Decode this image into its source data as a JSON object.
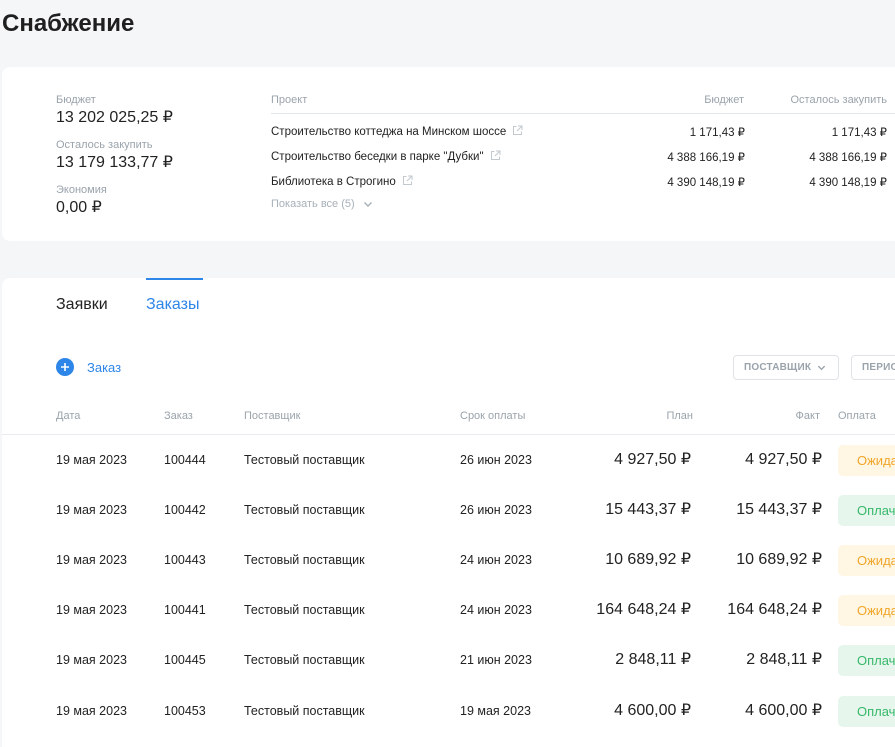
{
  "page": {
    "title": "Снабжение"
  },
  "summary": {
    "budget": {
      "label": "Бюджет",
      "value": "13 202 025,25 ₽"
    },
    "remaining": {
      "label": "Осталось закупить",
      "value": "13 179 133,77 ₽"
    },
    "savings": {
      "label": "Экономия",
      "value": "0,00 ₽"
    }
  },
  "projects": {
    "headers": {
      "project": "Проект",
      "budget": "Бюджет",
      "remaining": "Осталось закупить"
    },
    "rows": [
      {
        "name": "Строительство коттеджа на Минском шоссе",
        "budget": "1 171,43 ₽",
        "remaining": "1 171,43 ₽"
      },
      {
        "name": "Строительство беседки в парке \"Дубки\"",
        "budget": "4 388 166,19 ₽",
        "remaining": "4 388 166,19 ₽"
      },
      {
        "name": "Библиотека в Строгино",
        "budget": "4 390 148,19 ₽",
        "remaining": "4 390 148,19 ₽"
      }
    ],
    "show_all": "Показать все (5)"
  },
  "tabs": [
    {
      "label": "Заявки"
    },
    {
      "label": "Заказы"
    }
  ],
  "toolbar": {
    "add_label": "Заказ",
    "filter_supplier": "ПОСТАВЩИК",
    "filter_period": "ПЕРИОД"
  },
  "table": {
    "headers": {
      "date": "Дата",
      "order": "Заказ",
      "supplier": "Поставщик",
      "due": "Срок оплаты",
      "plan": "План",
      "fact": "Факт",
      "payment": "Оплата"
    },
    "rows": [
      {
        "date": "19 мая 2023",
        "order": "100444",
        "supplier": "Тестовый поставщик",
        "due": "26 июн 2023",
        "plan": "4 927,50 ₽",
        "fact": "4 927,50 ₽",
        "status": "Ожидает",
        "status_kind": "wait"
      },
      {
        "date": "19 мая 2023",
        "order": "100442",
        "supplier": "Тестовый поставщик",
        "due": "26 июн 2023",
        "plan": "15 443,37 ₽",
        "fact": "15 443,37 ₽",
        "status": "Оплачен",
        "status_kind": "paid"
      },
      {
        "date": "19 мая 2023",
        "order": "100443",
        "supplier": "Тестовый поставщик",
        "due": "24 июн 2023",
        "plan": "10 689,92 ₽",
        "fact": "10 689,92 ₽",
        "status": "Ожидает",
        "status_kind": "wait"
      },
      {
        "date": "19 мая 2023",
        "order": "100441",
        "supplier": "Тестовый поставщик",
        "due": "24 июн 2023",
        "plan": "164 648,24 ₽",
        "fact": "164 648,24 ₽",
        "status": "Ожидает",
        "status_kind": "wait"
      },
      {
        "date": "19 мая 2023",
        "order": "100445",
        "supplier": "Тестовый поставщик",
        "due": "21 июн 2023",
        "plan": "2 848,11 ₽",
        "fact": "2 848,11 ₽",
        "status": "Оплачен",
        "status_kind": "paid"
      },
      {
        "date": "19 мая 2023",
        "order": "100453",
        "supplier": "Тестовый поставщик",
        "due": "19 мая 2023",
        "plan": "4 600,00 ₽",
        "fact": "4 600,00 ₽",
        "status": "Оплачен",
        "status_kind": "paid"
      }
    ]
  },
  "colors": {
    "accent": "#2d86e8",
    "wait": "#f0a629",
    "paid": "#36b86a"
  }
}
